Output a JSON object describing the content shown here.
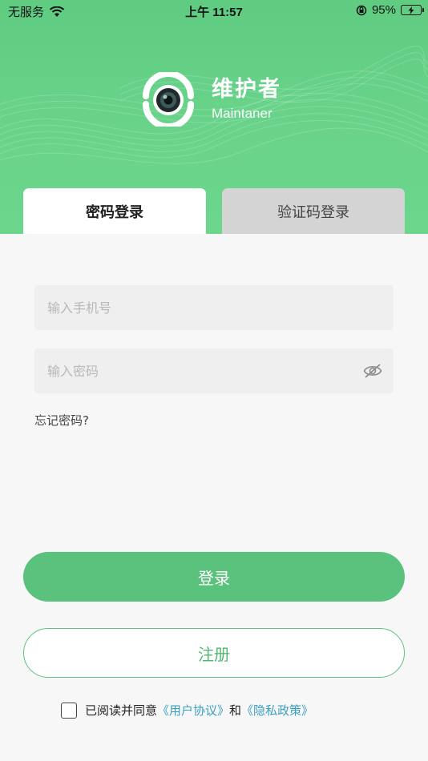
{
  "status_bar": {
    "carrier": "无服务",
    "time": "上午 11:57",
    "battery_percent": "95%",
    "wifi_icon": "wifi-icon",
    "rotation_lock_icon": "rotation-lock-icon",
    "battery_icon": "battery-charging-icon"
  },
  "brand": {
    "title": "维护者",
    "subtitle": "Maintaner",
    "logo_icon": "camera-lens-logo"
  },
  "tabs": {
    "password_login": "密码登录",
    "code_login": "验证码登录",
    "active": "password_login"
  },
  "form": {
    "phone_placeholder": "输入手机号",
    "phone_value": "",
    "password_placeholder": "输入密码",
    "password_value": "",
    "toggle_visibility_icon": "eye-hidden-icon",
    "forgot_password": "忘记密码?"
  },
  "buttons": {
    "login": "登录",
    "register": "注册"
  },
  "agreement": {
    "checked": false,
    "prefix": "已阅读并同意",
    "user_agreement": "《用户协议》",
    "and": "和",
    "privacy_policy": "《隐私政策》"
  },
  "colors": {
    "header_green": "#66d189",
    "primary_green": "#5ac27c",
    "link_blue": "#3a9fc2",
    "background": "#f7f7f7"
  }
}
